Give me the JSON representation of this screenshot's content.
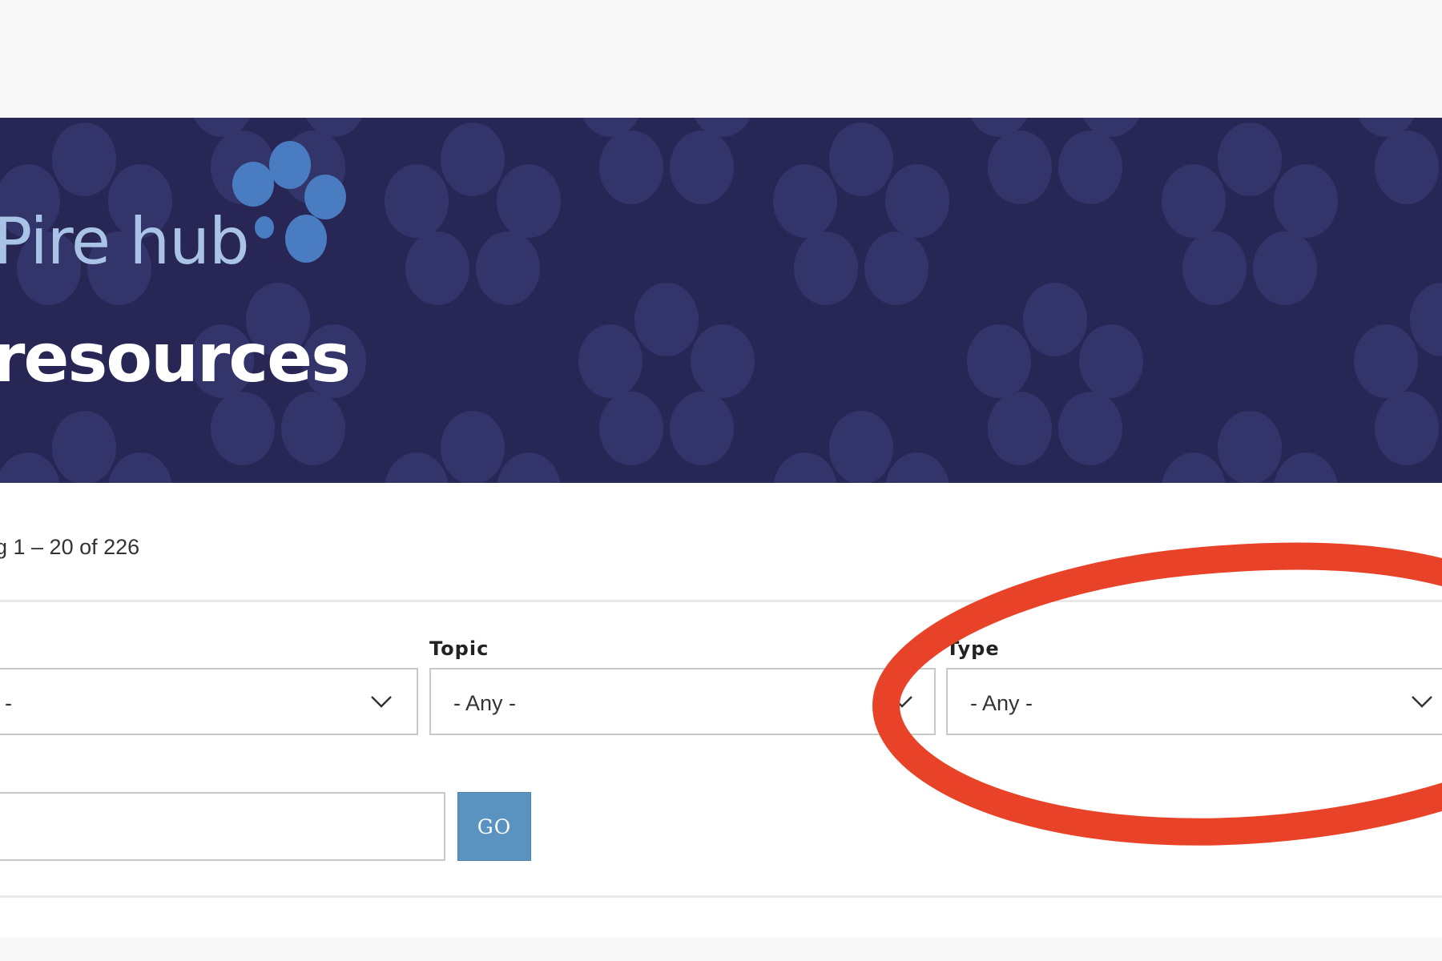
{
  "header": {
    "logo_text": "Pire hub",
    "page_title": "resources"
  },
  "results": {
    "count_text": "g 1 – 20 of 226"
  },
  "filters": {
    "first": {
      "value": "-"
    },
    "topic": {
      "label": "Topic",
      "value": "- Any -"
    },
    "type": {
      "label": "Type",
      "value": "- Any -"
    }
  },
  "search": {
    "value": "",
    "button_label": "GO"
  },
  "colors": {
    "banner": "#282655",
    "banner_pattern": "#33346a",
    "logo_text": "#a9c3e6",
    "logo_flower": "#4a7cc2",
    "button": "#5b93c0",
    "annotation": "#e84328"
  },
  "icons": {
    "dropdown": "chevron-down-icon",
    "logo": "flower-logo-icon",
    "annotation": "red-circle-annotation"
  }
}
